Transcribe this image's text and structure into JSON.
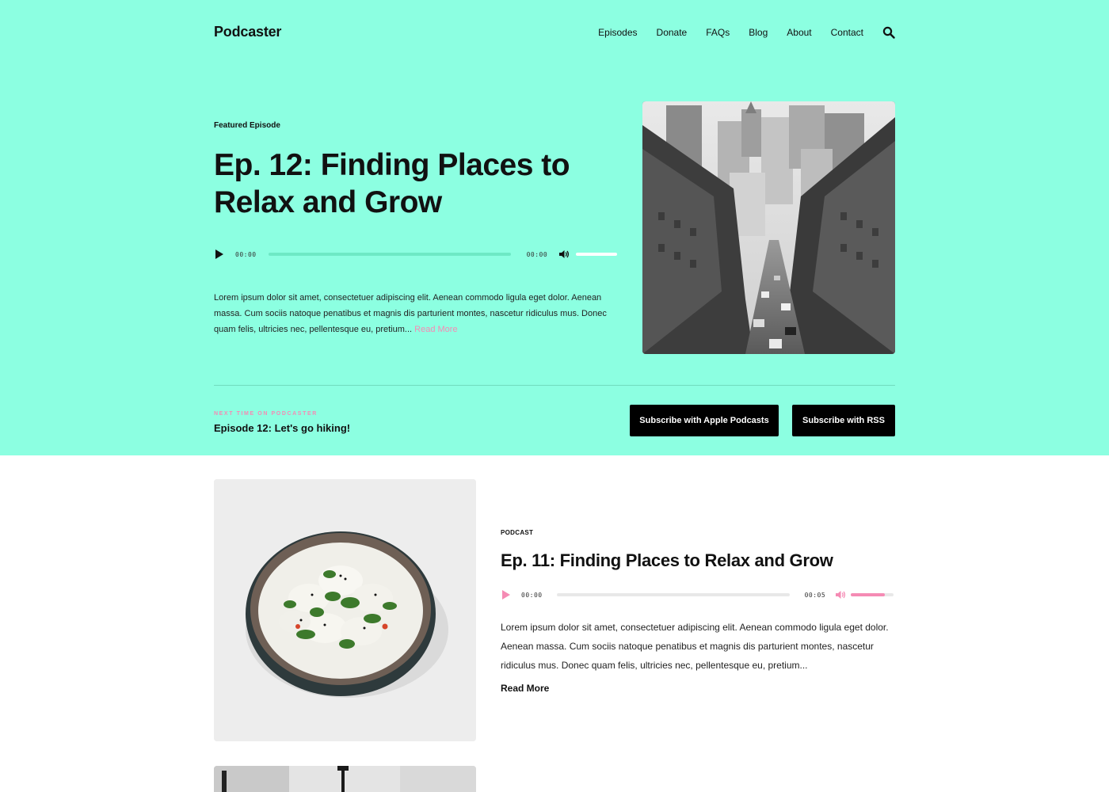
{
  "site": {
    "title": "Podcaster"
  },
  "nav": {
    "items": [
      "Episodes",
      "Donate",
      "FAQs",
      "Blog",
      "About",
      "Contact"
    ]
  },
  "icons": {
    "search": "search-icon",
    "play": "play-icon",
    "volume": "volume-icon"
  },
  "colors": {
    "hero_bg": "#8cffe1",
    "accent": "#f58bb4",
    "button_bg": "#000000"
  },
  "featured": {
    "label": "Featured Episode",
    "title": "Ep. 12: Finding Places to Relax and Grow",
    "player": {
      "current_time": "00:00",
      "duration": "00:00"
    },
    "excerpt": "Lorem ipsum dolor sit amet, consectetuer adipiscing elit. Aenean commodo ligula eget dolor. Aenean massa. Cum sociis natoque penatibus et magnis dis parturient montes, nascetur ridiculus mus. Donec quam felis, ultricies nec, pellentesque eu, pretium...",
    "read_more": "Read More"
  },
  "next": {
    "label": "NEXT TIME ON PODCASTER",
    "title": "Episode 12: Let's go hiking!"
  },
  "subscribe": {
    "apple": "Subscribe with Apple Podcasts",
    "rss": "Subscribe with RSS"
  },
  "post": {
    "category": "PODCAST",
    "title": "Ep. 11: Finding Places to Relax and Grow",
    "player": {
      "current_time": "00:00",
      "duration": "00:05",
      "volume_fraction": 0.8
    },
    "excerpt": "Lorem ipsum dolor sit amet, consectetuer adipiscing elit. Aenean commodo ligula eget dolor. Aenean massa. Cum sociis natoque penatibus et magnis dis parturient montes, nascetur ridiculus mus. Donec quam felis, ultricies nec, pellentesque eu, pretium...",
    "read_more": "Read More"
  }
}
